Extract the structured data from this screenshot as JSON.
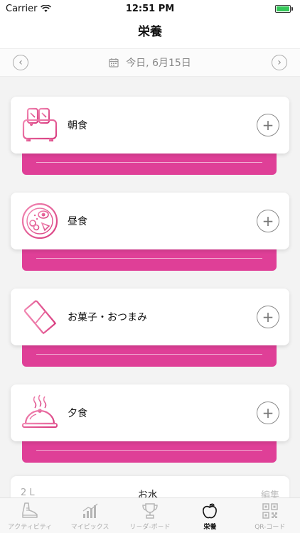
{
  "status_bar": {
    "carrier": "Carrier",
    "time": "12:51 PM"
  },
  "header": {
    "title": "栄養"
  },
  "date_bar": {
    "label": "今日, 6月15日"
  },
  "meals": [
    {
      "label": "朝食",
      "icon": "toaster-icon"
    },
    {
      "label": "昼食",
      "icon": "plate-icon"
    },
    {
      "label": "お菓子・おつまみ",
      "icon": "chocolate-icon"
    },
    {
      "label": "夕食",
      "icon": "cloche-icon"
    }
  ],
  "water": {
    "amount": "2 L",
    "title": "お水",
    "edit": "編集"
  },
  "tabs": [
    {
      "label": "アクティビティ",
      "icon": "shoe-icon",
      "active": false
    },
    {
      "label": "マイピックス",
      "icon": "bar-chart-icon",
      "active": false
    },
    {
      "label": "リ－ダ-ボ－ド",
      "icon": "trophy-icon",
      "active": false
    },
    {
      "label": "栄養",
      "icon": "apple-icon",
      "active": true
    },
    {
      "label": "QR-コード",
      "icon": "qr-code-icon",
      "active": false
    }
  ],
  "colors": {
    "accent": "#df3f97",
    "accent_light": "#f06aa6",
    "plus_gray": "#8a8a8a"
  }
}
